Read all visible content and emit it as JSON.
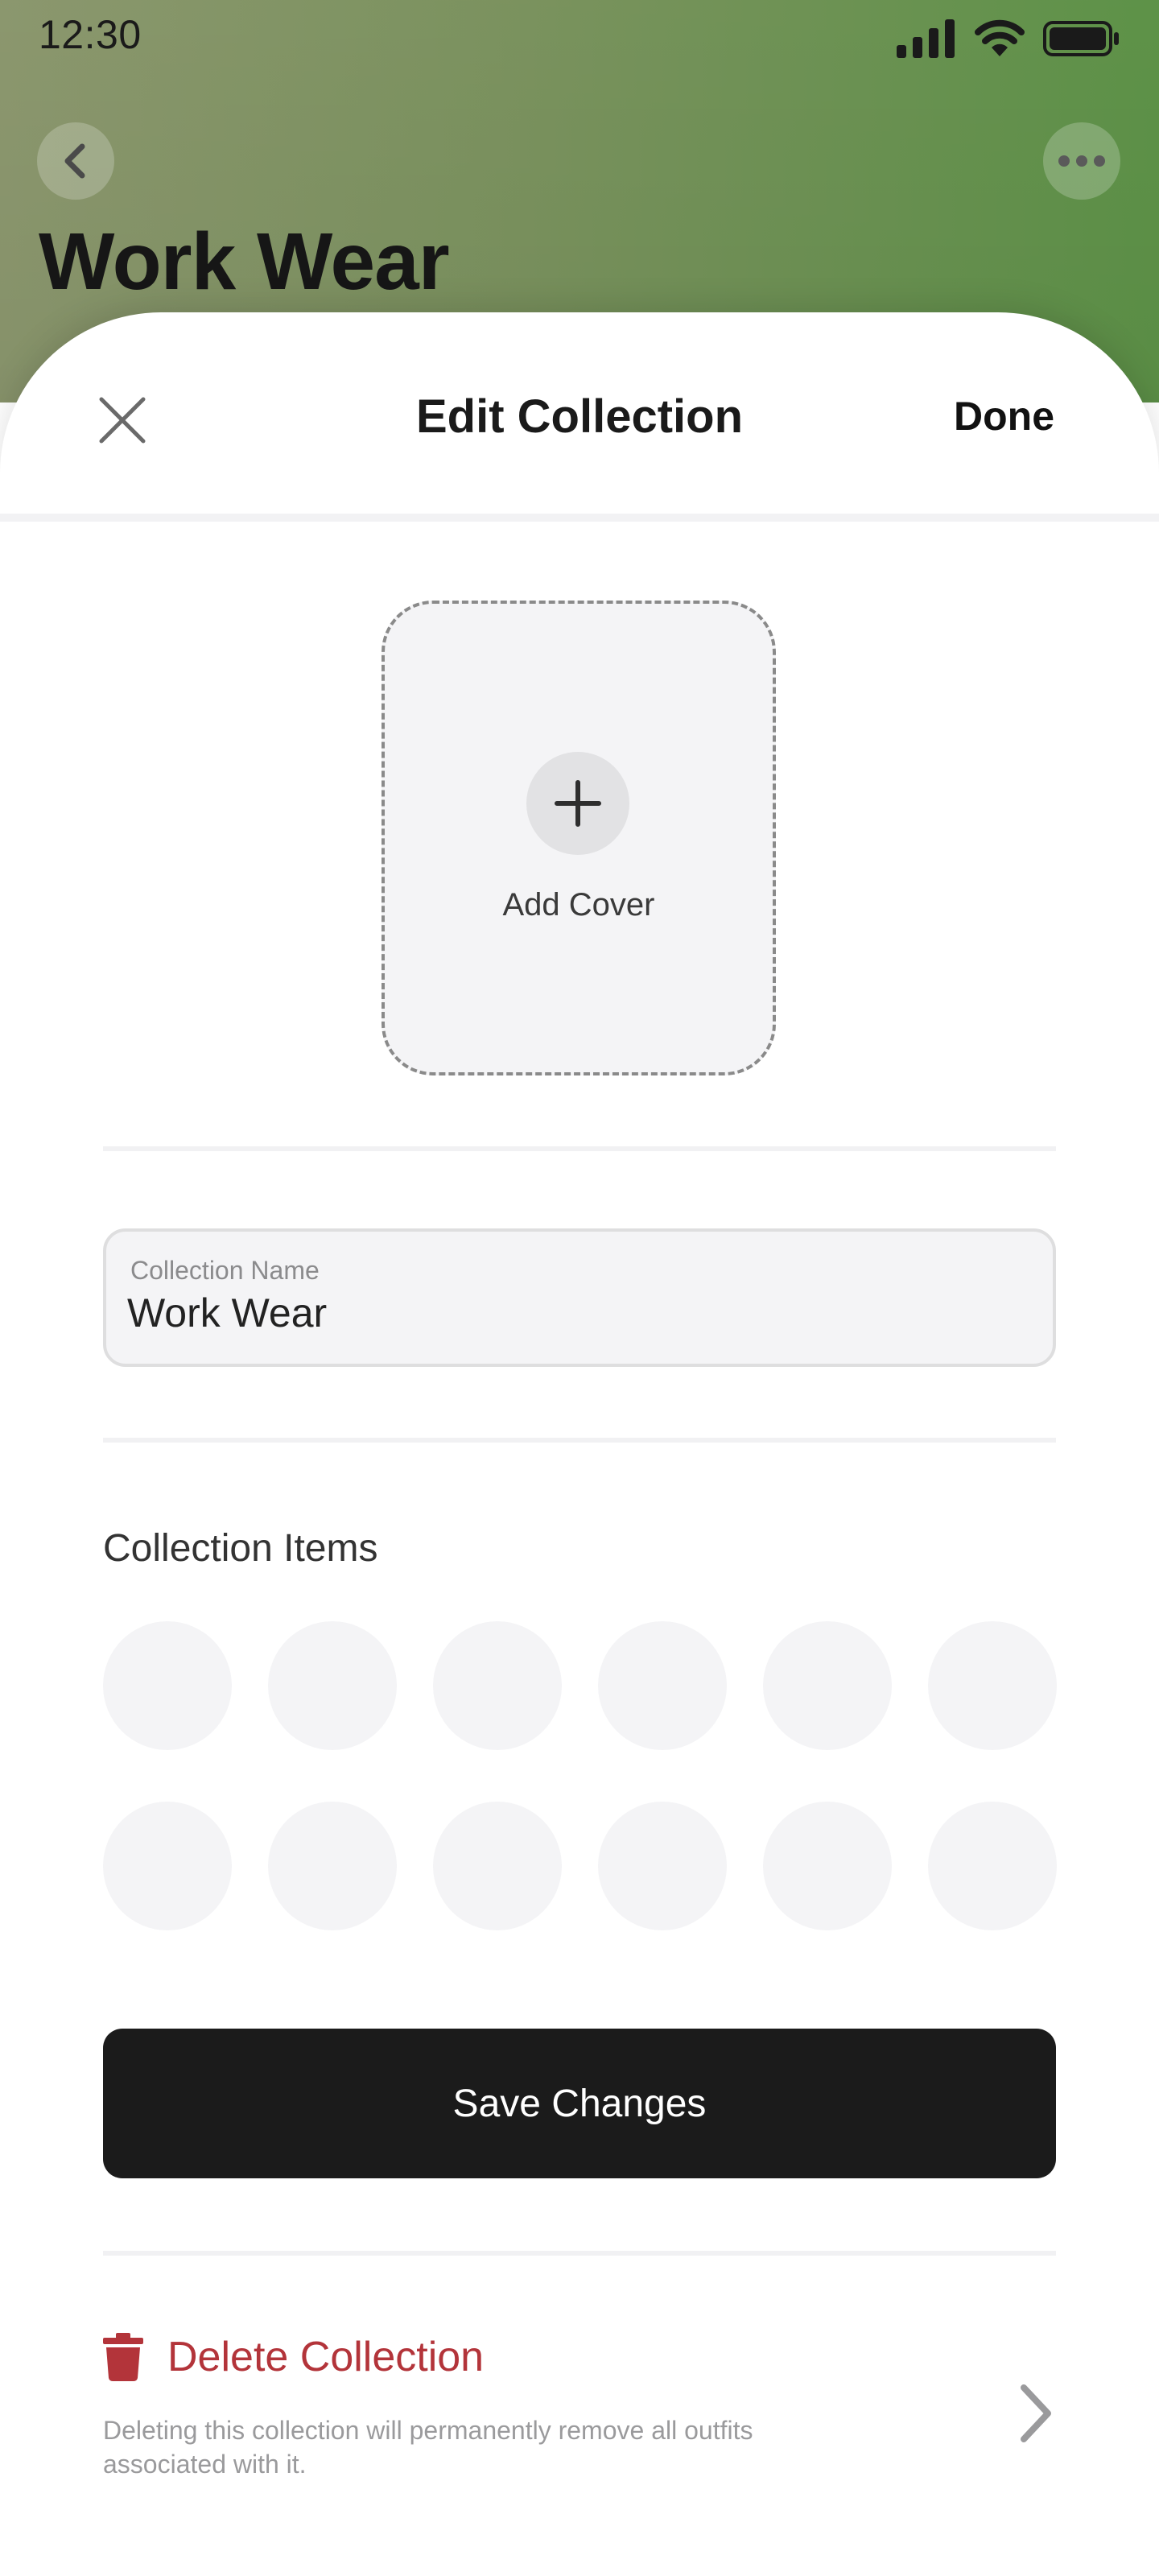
{
  "status_bar": {
    "time": "12:30",
    "icons": [
      "signal-icon",
      "wifi-icon",
      "battery-icon"
    ]
  },
  "background_page": {
    "title": "Work Wear",
    "back_icon": "chevron-left-icon",
    "more_icon": "more-horizontal-icon"
  },
  "sheet": {
    "title": "Edit Collection",
    "close_icon": "close-icon",
    "done_label": "Done"
  },
  "cover": {
    "label": "Add Cover",
    "icon": "plus-icon"
  },
  "collection_name": {
    "label": "Collection Name",
    "value": "Work Wear"
  },
  "collection_items": {
    "title": "Collection Items",
    "slots": 12
  },
  "actions": {
    "save_label": "Save Changes",
    "delete_label": "Delete Collection",
    "delete_description": "Deleting this collection will permanently remove all outfits associated with it.",
    "delete_icon": "trash-icon",
    "chevron_icon": "chevron-right-icon"
  },
  "colors": {
    "danger": "#b3343a",
    "primary_button": "#1b1b1b",
    "background_green": "#6f9555"
  }
}
